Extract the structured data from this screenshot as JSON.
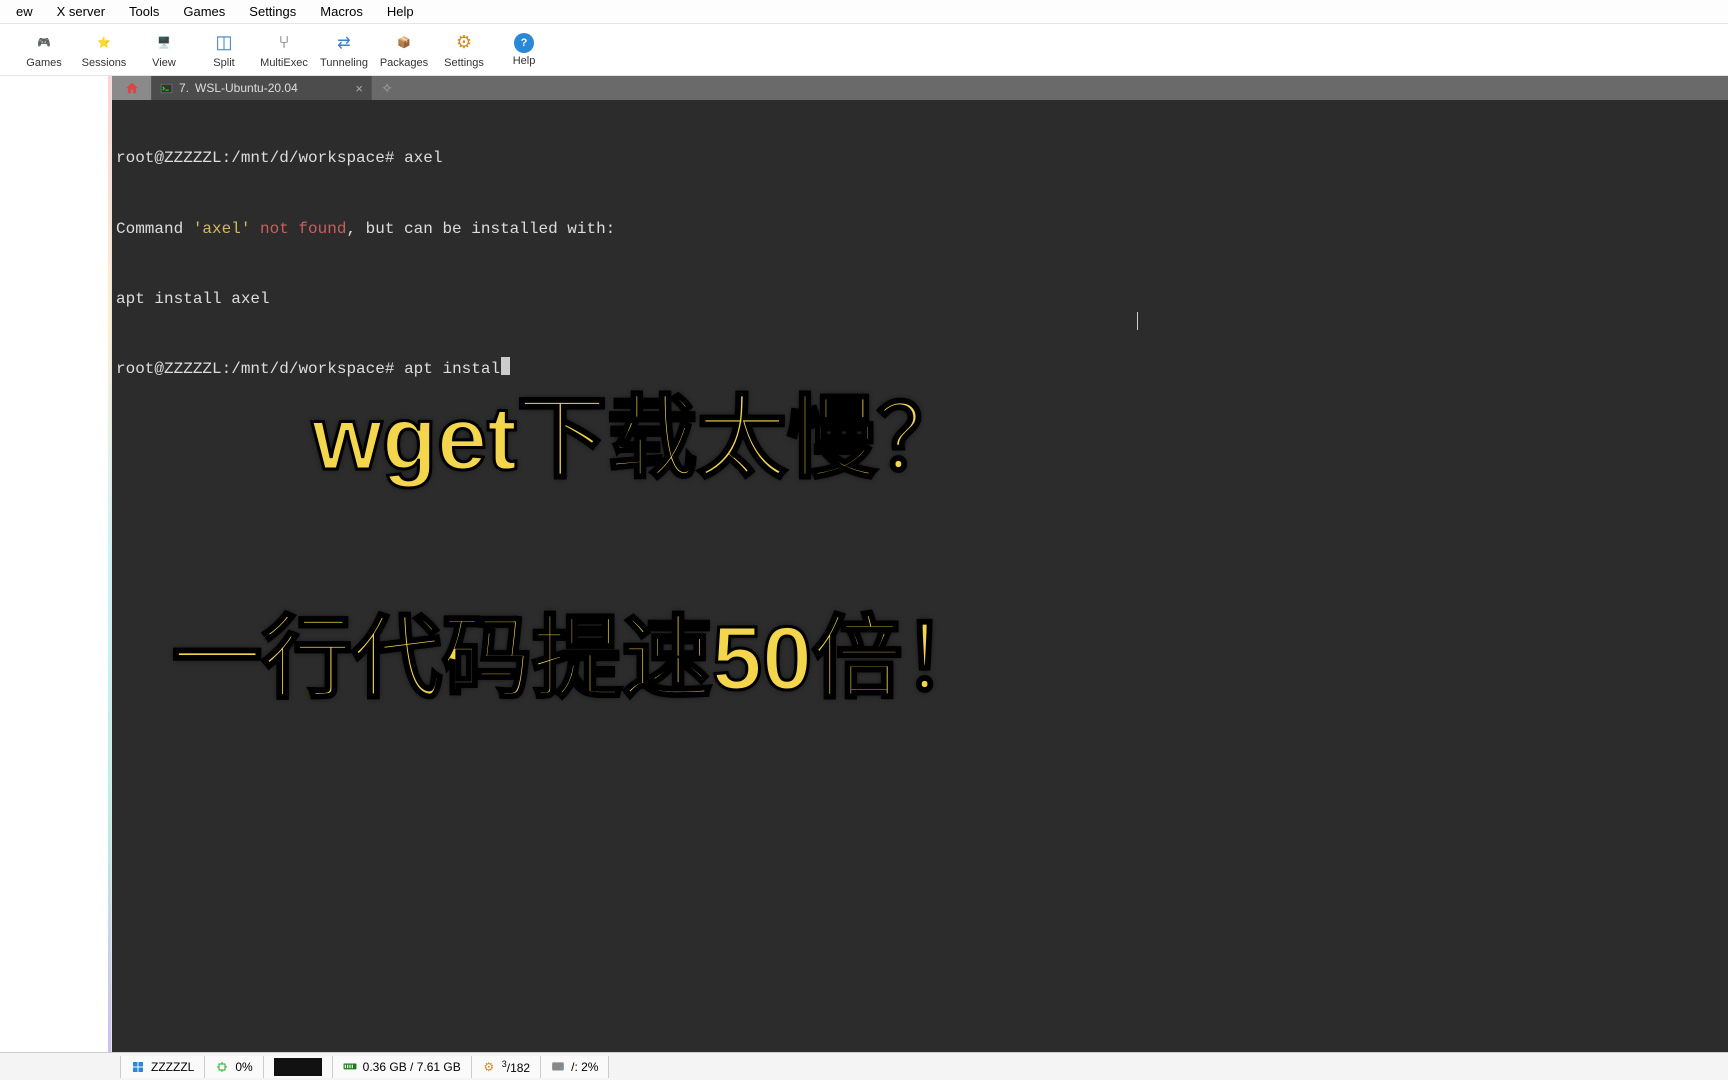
{
  "menu": {
    "items": [
      "ew",
      "X server",
      "Tools",
      "Games",
      "Settings",
      "Macros",
      "Help"
    ]
  },
  "toolbar": {
    "items": [
      {
        "name": "games",
        "label": "Games",
        "icon": "🎮"
      },
      {
        "name": "sessions",
        "label": "Sessions",
        "icon": "⭐"
      },
      {
        "name": "view",
        "label": "View",
        "icon": "🖥️"
      },
      {
        "name": "split",
        "label": "Split",
        "icon": "◫"
      },
      {
        "name": "multiexec",
        "label": "MultiExec",
        "icon": "⑂"
      },
      {
        "name": "tunneling",
        "label": "Tunneling",
        "icon": "⇄"
      },
      {
        "name": "packages",
        "label": "Packages",
        "icon": "📦"
      },
      {
        "name": "settings",
        "label": "Settings",
        "icon": "⚙"
      },
      {
        "name": "help",
        "label": "Help",
        "icon": "?"
      }
    ]
  },
  "tabs": {
    "active": {
      "index": "7.",
      "title": "WSL-Ubuntu-20.04"
    }
  },
  "terminal": {
    "prompt1_user": "root@ZZZZZL",
    "prompt1_path": ":/mnt/d/workspace# ",
    "cmd1": "axel",
    "err_pre": "Command ",
    "err_cmd": "'axel'",
    "err_not": " not found",
    "err_post": ", but can be installed with:",
    "suggest": "apt install axel",
    "prompt2_user": "root@ZZZZZL",
    "prompt2_path": ":/mnt/d/workspace# ",
    "cmd2": "apt instal"
  },
  "overlay": {
    "line1": "wget下载太慢？",
    "line2": "一行代码提速50倍！"
  },
  "status": {
    "host": "ZZZZZL",
    "cpu": "0%",
    "mem": "0.36 GB / 7.61 GB",
    "proc_top": "3",
    "proc_bottom": "/182",
    "disk": "/: 2%"
  }
}
